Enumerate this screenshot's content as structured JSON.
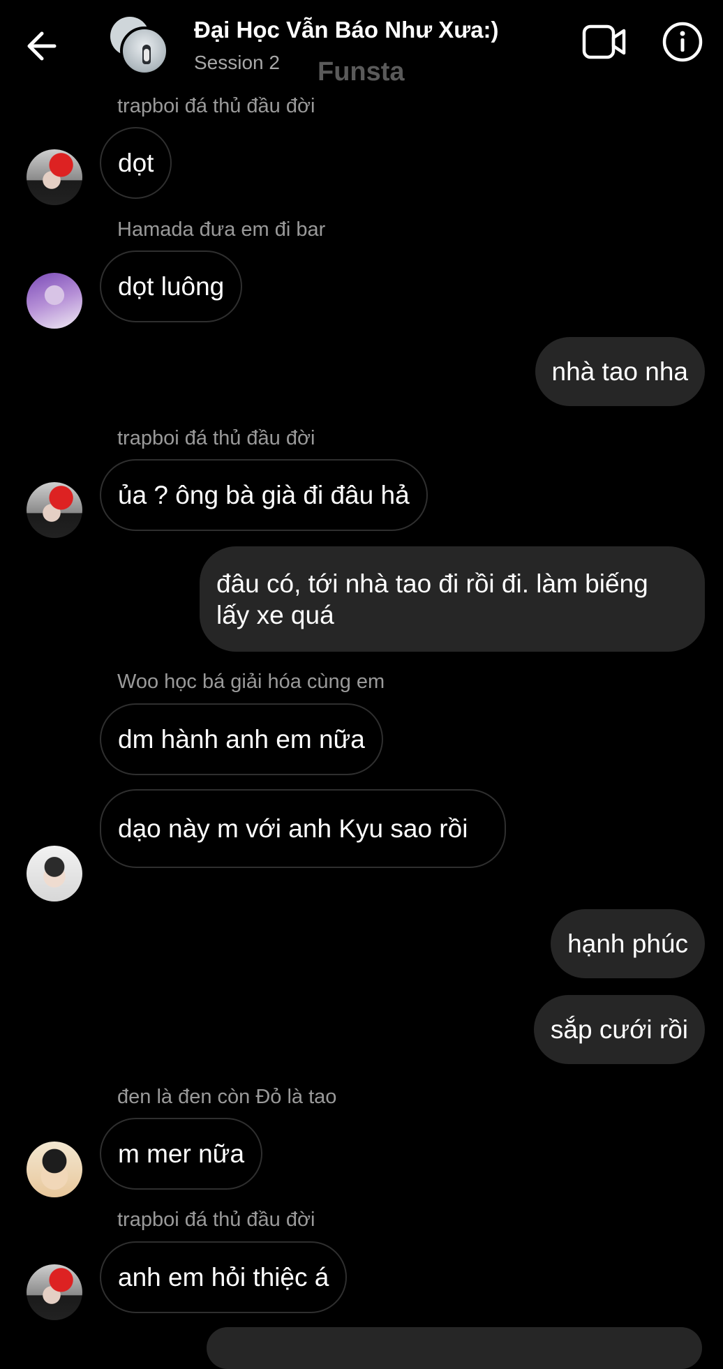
{
  "header": {
    "back_icon": "arrow-left-icon",
    "title": "Đại Học Vẫn Báo Như Xưa:)",
    "subtitle": "Session 2",
    "watermark": "Funsta",
    "video_icon": "video-camera-icon",
    "info_icon": "info-icon"
  },
  "messages": [
    {
      "sender": "trapboi đá thủ đầu đời",
      "text": "dọt",
      "direction": "in"
    },
    {
      "sender": "Hamada đưa em đi bar",
      "text": "dọt luông",
      "direction": "in"
    },
    {
      "text": "nhà tao nha",
      "direction": "out"
    },
    {
      "sender": "trapboi đá thủ đầu đời",
      "text": "ủa ? ông bà già đi đâu hả",
      "direction": "in"
    },
    {
      "text": "đâu có, tới nhà tao đi rồi đi. làm biếng lấy xe quá",
      "direction": "out"
    },
    {
      "sender": "Woo học bá giải hóa cùng em",
      "text": "dm hành anh em nữa",
      "direction": "in"
    },
    {
      "text": "dạo này m với anh Kyu sao rồi",
      "direction": "in"
    },
    {
      "text": "hạnh phúc",
      "direction": "out"
    },
    {
      "text": "sắp cưới rồi",
      "direction": "out"
    },
    {
      "sender": "đen là đen còn Đỏ là tao",
      "text": "m mer nữa",
      "direction": "in"
    },
    {
      "sender": "trapboi đá thủ đầu đời",
      "text": "anh em hỏi thiệc á",
      "direction": "in"
    }
  ]
}
